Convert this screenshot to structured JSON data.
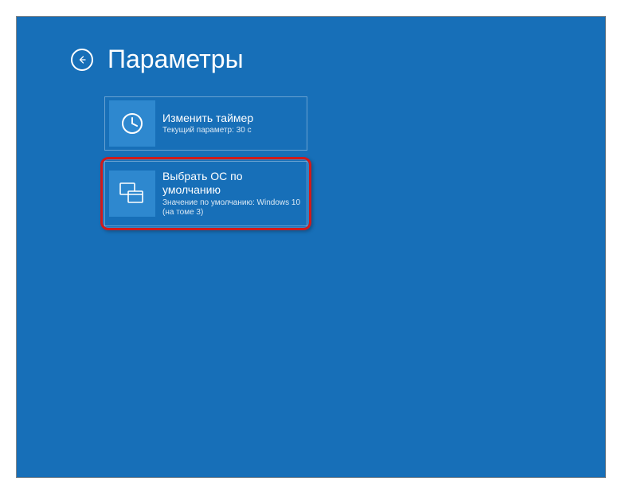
{
  "header": {
    "title": "Параметры"
  },
  "tiles": {
    "timer": {
      "title": "Изменить таймер",
      "subtitle": "Текущий параметр: 30 с"
    },
    "default_os": {
      "title": "Выбрать ОС по умолчанию",
      "subtitle": "Значение по умолчанию: Windows 10 (на томе 3)"
    }
  }
}
